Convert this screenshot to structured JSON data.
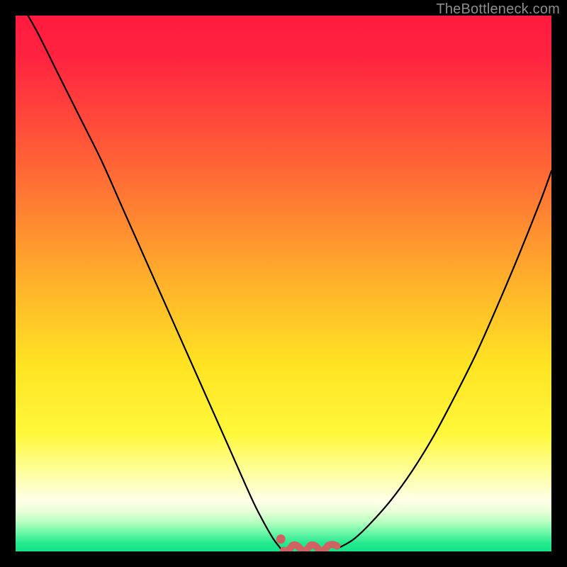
{
  "watermark": {
    "text": "TheBottleneck.com"
  },
  "colors": {
    "background": "#000000",
    "gradient_stops": [
      {
        "offset": 0.0,
        "color": "#ff1a3e"
      },
      {
        "offset": 0.08,
        "color": "#ff2440"
      },
      {
        "offset": 0.2,
        "color": "#ff4a3a"
      },
      {
        "offset": 0.35,
        "color": "#ff7d33"
      },
      {
        "offset": 0.5,
        "color": "#ffb22b"
      },
      {
        "offset": 0.65,
        "color": "#ffe323"
      },
      {
        "offset": 0.78,
        "color": "#fff83a"
      },
      {
        "offset": 0.86,
        "color": "#feffa8"
      },
      {
        "offset": 0.905,
        "color": "#ffffe8"
      },
      {
        "offset": 0.925,
        "color": "#e8ffd8"
      },
      {
        "offset": 0.945,
        "color": "#b8ffc0"
      },
      {
        "offset": 0.965,
        "color": "#6cf7a8"
      },
      {
        "offset": 0.985,
        "color": "#24e98e"
      },
      {
        "offset": 1.0,
        "color": "#13e387"
      }
    ],
    "curve": "#000000",
    "marker": "#d16262"
  },
  "chart_data": {
    "type": "line",
    "title": "",
    "xlabel": "",
    "ylabel": "",
    "xlim": [
      0,
      100
    ],
    "ylim": [
      0,
      100
    ],
    "series": [
      {
        "name": "left-curve",
        "x": [
          0,
          4,
          8,
          12,
          16,
          20,
          24,
          28,
          32,
          36,
          40,
          44,
          46,
          48,
          49.5
        ],
        "values": [
          104,
          97,
          89,
          81,
          73,
          64,
          55,
          46,
          37,
          28,
          19,
          10,
          6,
          2.5,
          0.5
        ]
      },
      {
        "name": "right-curve",
        "x": [
          60,
          63,
          66,
          70,
          74,
          78,
          82,
          86,
          90,
          94,
          98,
          100
        ],
        "values": [
          0.5,
          2.2,
          5,
          9.5,
          15,
          21.5,
          29,
          37,
          46,
          55.5,
          65.5,
          71
        ]
      }
    ],
    "annotations": [
      {
        "name": "floor-squiggle",
        "x_range": [
          50,
          60
        ],
        "y": 0.6
      },
      {
        "name": "marker-dot",
        "x": 49.5,
        "y": 2.3
      }
    ]
  }
}
